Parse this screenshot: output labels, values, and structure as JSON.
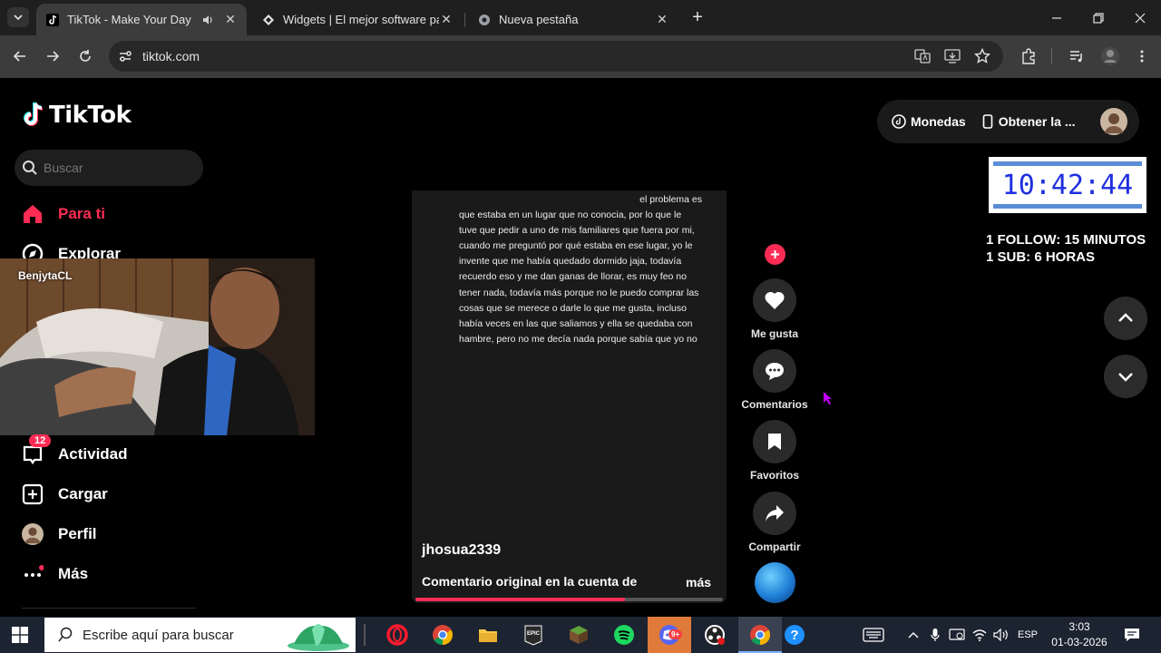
{
  "browser": {
    "tabs": [
      {
        "title": "TikTok - Make Your Day",
        "active": true
      },
      {
        "title": "Widgets | El mejor software par",
        "active": false
      },
      {
        "title": "Nueva pestaña",
        "active": false
      }
    ],
    "url": "tiktok.com"
  },
  "tiktok": {
    "logo": "TikTok",
    "search_placeholder": "Buscar",
    "nav": [
      {
        "label": "Para ti",
        "icon": "home-icon",
        "active": true
      },
      {
        "label": "Explorar",
        "icon": "compass-icon"
      },
      {
        "label": "Actividad",
        "icon": "inbox-icon",
        "badge": "12"
      },
      {
        "label": "Cargar",
        "icon": "upload-icon"
      },
      {
        "label": "Perfil",
        "icon": "avatar"
      },
      {
        "label": "Más",
        "icon": "more-icon"
      }
    ],
    "topbar": {
      "coins": "Monedas",
      "get_app": "Obtener la ..."
    },
    "video": {
      "text_lines": [
        "el problema es",
        "que estaba en un lugar que no conocia, por lo que le",
        "tuve que pedir a uno de mis familiares que fuera por mi,",
        "cuando me preguntó por qué estaba en ese lugar, yo le",
        "invente que me había quedado dormido jaja, todavía",
        "recuerdo eso y me dan ganas de llorar, es muy feo no",
        "tener nada, todavía más porque no le puedo comprar las",
        "cosas que se merece o darle lo que me gusta, incluso",
        "había veces en las que saliamos y ella se quedaba con",
        "hambre, pero no me decía nada porque sabía que yo no"
      ],
      "author": "jhosua2339",
      "description": "Comentario original en la cuenta de",
      "more": "más",
      "progress": 0.68
    },
    "actions": {
      "like": "Me gusta",
      "comments": "Comentarios",
      "favorites": "Favoritos",
      "share": "Compartir"
    }
  },
  "stream_overlay": {
    "webcam_name": "BenjytaCL",
    "timer": "10:42:44",
    "follow_text": "1 FOLLOW: 15 MINUTOS",
    "sub_text": "1 SUB: 6 HORAS"
  },
  "taskbar": {
    "search_placeholder": "Escribe aquí para buscar",
    "language": "ESP",
    "time": "3:03",
    "date": "01-03-2026",
    "discord_badge": "9+"
  },
  "colors": {
    "accent": "#fe2c55",
    "timer": "#1f2fe0"
  }
}
